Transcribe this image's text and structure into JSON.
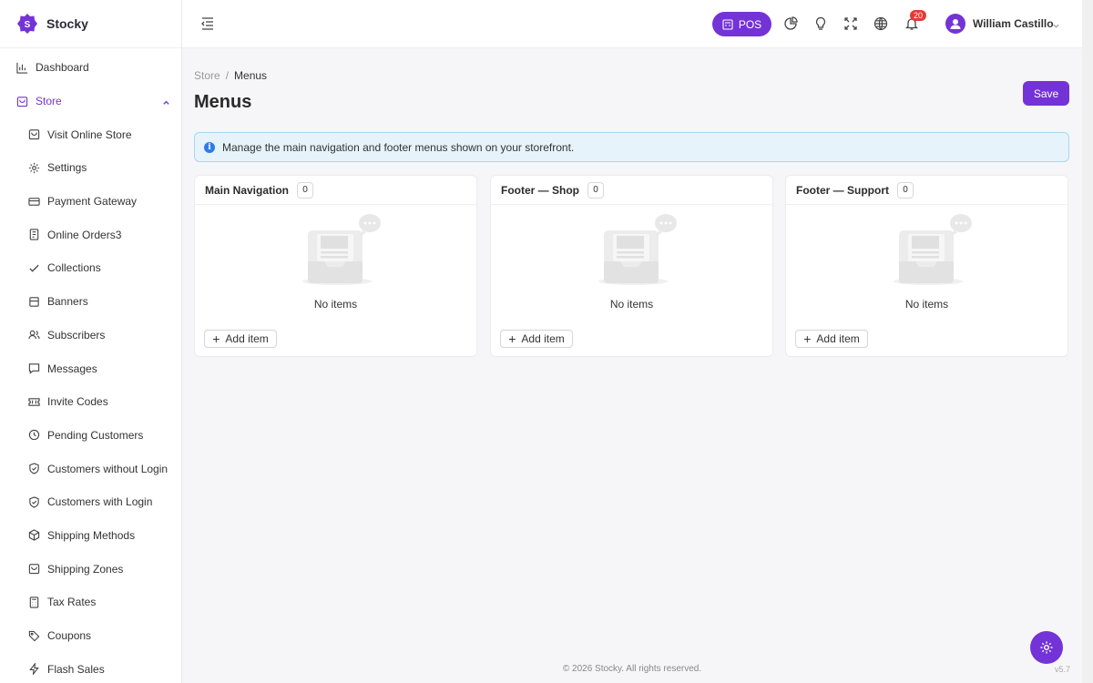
{
  "brand": {
    "name": "Stocky",
    "logo_letter": "S",
    "color": "#7433d6"
  },
  "sidebar": {
    "items": [
      {
        "label": "Dashboard",
        "icon": "bar-chart-icon",
        "sub": false,
        "active": false
      },
      {
        "label": "Store",
        "icon": "store-bag-icon",
        "sub": false,
        "active": true,
        "expanded": true
      },
      {
        "label": "Visit Online Store",
        "icon": "bag-icon",
        "sub": true
      },
      {
        "label": "Settings",
        "icon": "gear-icon",
        "sub": true
      },
      {
        "label": "Payment Gateway",
        "icon": "credit-card-icon",
        "sub": true
      },
      {
        "label": "Online Orders3",
        "icon": "receipt-icon",
        "sub": true
      },
      {
        "label": "Collections",
        "icon": "check-icon",
        "sub": true
      },
      {
        "label": "Banners",
        "icon": "banner-icon",
        "sub": true
      },
      {
        "label": "Subscribers",
        "icon": "users-icon",
        "sub": true
      },
      {
        "label": "Messages",
        "icon": "message-icon",
        "sub": true
      },
      {
        "label": "Invite Codes",
        "icon": "ticket-icon",
        "sub": true
      },
      {
        "label": "Pending Customers",
        "icon": "clock-icon",
        "sub": true
      },
      {
        "label": "Customers without Login",
        "icon": "shield-check-icon",
        "sub": true
      },
      {
        "label": "Customers with Login",
        "icon": "shield-check-icon",
        "sub": true
      },
      {
        "label": "Shipping Methods",
        "icon": "box-icon",
        "sub": true
      },
      {
        "label": "Shipping Zones",
        "icon": "bag-icon",
        "sub": true
      },
      {
        "label": "Tax Rates",
        "icon": "calculator-icon",
        "sub": true
      },
      {
        "label": "Coupons",
        "icon": "tag-icon",
        "sub": true
      },
      {
        "label": "Flash Sales",
        "icon": "bolt-icon",
        "sub": true
      }
    ]
  },
  "topbar": {
    "pos_label": "POS",
    "notification_count": "20",
    "user_name": "William Castillo"
  },
  "breadcrumb": {
    "parent": "Store",
    "separator": "/",
    "current": "Menus"
  },
  "page": {
    "title": "Menus",
    "save_label": "Save",
    "info": "Manage the main navigation and footer menus shown on your storefront."
  },
  "cards": [
    {
      "title": "Main Navigation",
      "count": "0",
      "empty_text": "No items",
      "add_label": "Add item"
    },
    {
      "title": "Footer — Shop",
      "count": "0",
      "empty_text": "No items",
      "add_label": "Add item"
    },
    {
      "title": "Footer — Support",
      "count": "0",
      "empty_text": "No items",
      "add_label": "Add item"
    }
  ],
  "footer": {
    "copyright": "© 2026 Stocky. All rights reserved.",
    "version": "v5.7"
  },
  "colors": {
    "accent": "#7433d6",
    "badge": "#e53935",
    "info": "#2e7ce6",
    "info_bg": "#e6f3fb"
  }
}
